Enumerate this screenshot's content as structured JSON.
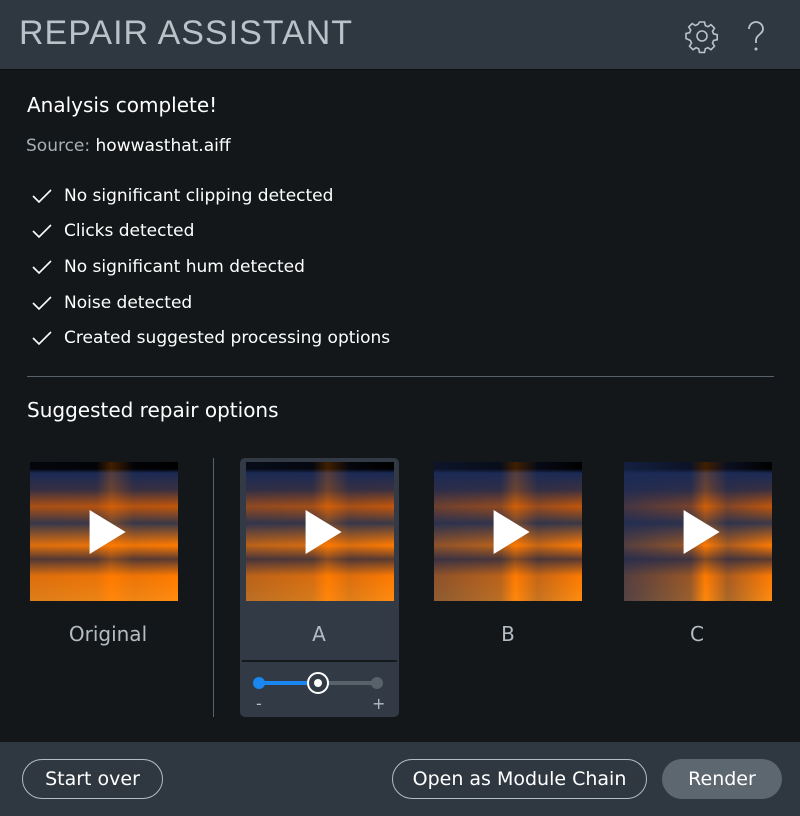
{
  "header": {
    "title": "REPAIR ASSISTANT",
    "settings_icon": "gear-icon",
    "help_icon": "question-icon"
  },
  "analysis": {
    "heading": "Analysis complete!",
    "source_label": "Source:",
    "source_file": "howwasthat.aiff",
    "results": [
      "No significant clipping detected",
      "Clicks detected",
      "No significant hum detected",
      "Noise detected",
      "Created suggested processing options"
    ]
  },
  "suggestions": {
    "heading": "Suggested repair options",
    "options": [
      {
        "label": "Original"
      },
      {
        "label": "A",
        "selected": true
      },
      {
        "label": "B"
      },
      {
        "label": "C"
      }
    ],
    "strength": {
      "value": 0.5,
      "min_label": "-",
      "max_label": "+"
    }
  },
  "colors": {
    "accent": "#1a86f0",
    "spectrogram_hot": "#ff7a00",
    "spectrogram_cold": "#1b2a55"
  },
  "footer": {
    "start_over": "Start over",
    "open_chain": "Open as Module Chain",
    "render": "Render"
  }
}
